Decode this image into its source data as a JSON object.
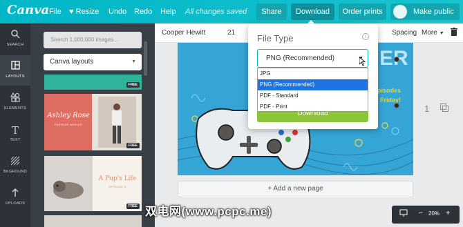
{
  "app": {
    "logo": "Canva"
  },
  "topbar": {
    "file": "File",
    "resize": "Resize",
    "undo": "Undo",
    "redo": "Redo",
    "help": "Help",
    "saved_status": "All changes saved",
    "share": "Share",
    "download": "Download",
    "order_prints": "Order prints",
    "make_public": "Make public"
  },
  "rail": [
    {
      "label": "SEARCH",
      "icon": "search-icon"
    },
    {
      "label": "LAYOUTS",
      "icon": "layouts-icon"
    },
    {
      "label": "ELEMENTS",
      "icon": "elements-icon"
    },
    {
      "label": "TEXT",
      "icon": "text-icon"
    },
    {
      "label": "BKGROUND",
      "icon": "background-icon"
    },
    {
      "label": "UPLOADS",
      "icon": "uploads-icon"
    }
  ],
  "panel": {
    "search_placeholder": "Search 1,000,000 images...",
    "layouts_dropdown": "Canva layouts",
    "thumbs": [
      {
        "badge": "FREE"
      },
      {
        "title": "Ashley Rose",
        "subtitle": "FASHION ADVICE",
        "badge": "FREE"
      },
      {
        "title": "A Pup's Life",
        "subtitle": "EPISODE 6",
        "badge": "FREE"
      }
    ]
  },
  "toolbar": {
    "font": "Cooper Hewitt",
    "size": "21",
    "spacing": "Spacing",
    "more": "More"
  },
  "canvas": {
    "headline_fragment": "ER",
    "yellow_line1": "Episodes",
    "yellow_line2": "Friday!",
    "page_number": "1",
    "add_page": "+ Add a new page"
  },
  "zoom": {
    "value": "20%",
    "minus": "–",
    "plus": "+"
  },
  "watermark": "双电网(www.pcpc.me)",
  "download_popup": {
    "title": "File Type",
    "info": "i",
    "selected": "PNG (Recommended)",
    "options": [
      "JPG",
      "PNG (Recommended)",
      "PDF - Standard",
      "PDF - Print"
    ],
    "highlighted_index": 1,
    "button": "Download"
  },
  "colors": {
    "topbar": "#00c4cc",
    "rail": "#2c3238",
    "panel": "#383f46",
    "canvas_bg": "#35a5d6",
    "download_green": "#8cc43a",
    "option_highlight": "#1e73e0"
  }
}
